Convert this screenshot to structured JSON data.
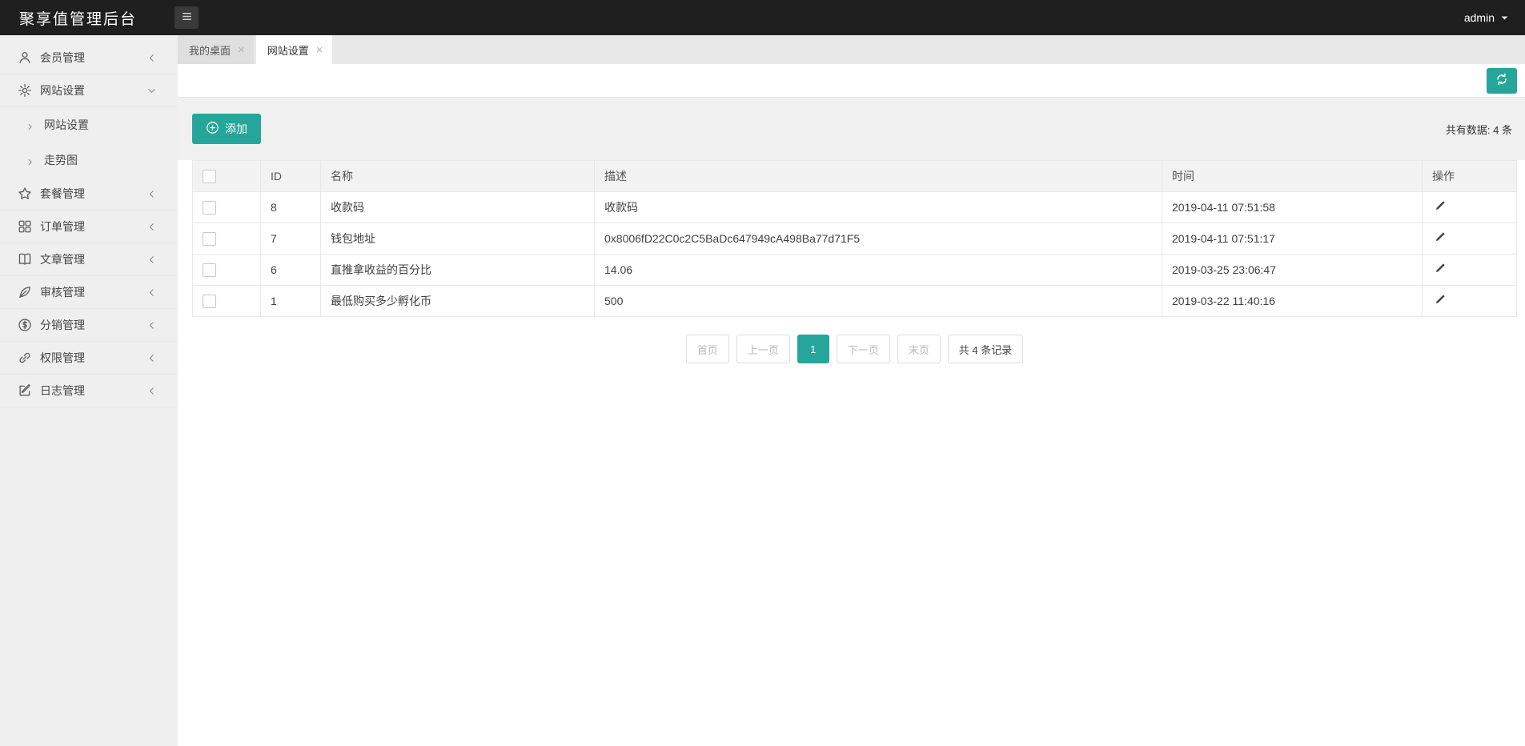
{
  "header": {
    "title": "聚享值管理后台",
    "user": "admin"
  },
  "tabs": [
    {
      "label": "我的桌面",
      "active": false
    },
    {
      "label": "网站设置",
      "active": true
    }
  ],
  "sidebar": {
    "items": [
      {
        "key": "member",
        "label": "会员管理",
        "icon": "user-icon",
        "state": "collapsed"
      },
      {
        "key": "site",
        "label": "网站设置",
        "icon": "gear-icon",
        "state": "expanded",
        "children": [
          "网站设置",
          "走势图"
        ]
      },
      {
        "key": "package",
        "label": "套餐管理",
        "icon": "star-icon",
        "state": "collapsed"
      },
      {
        "key": "order",
        "label": "订单管理",
        "icon": "grid-icon",
        "state": "collapsed"
      },
      {
        "key": "article",
        "label": "文章管理",
        "icon": "book-icon",
        "state": "collapsed"
      },
      {
        "key": "audit",
        "label": "审核管理",
        "icon": "audit-icon",
        "state": "collapsed"
      },
      {
        "key": "resell",
        "label": "分销管理",
        "icon": "dollar-icon",
        "state": "collapsed"
      },
      {
        "key": "perm",
        "label": "权限管理",
        "icon": "link-icon",
        "state": "collapsed"
      },
      {
        "key": "log",
        "label": "日志管理",
        "icon": "edit-icon",
        "state": "collapsed"
      }
    ]
  },
  "toolbar": {
    "add_label": "添加",
    "total_text": "共有数据: 4 条"
  },
  "table": {
    "headers": [
      "ID",
      "名称",
      "描述",
      "时间",
      "操作"
    ],
    "rows": [
      {
        "id": "8",
        "name": "收款码",
        "desc": "收款码",
        "time": "2019-04-11 07:51:58"
      },
      {
        "id": "7",
        "name": "钱包地址",
        "desc": "0x8006fD22C0c2C5BaDc647949cA498Ba77d71F5",
        "time": "2019-04-11 07:51:17"
      },
      {
        "id": "6",
        "name": "直推拿收益的百分比",
        "desc": "14.06",
        "time": "2019-03-25 23:06:47"
      },
      {
        "id": "1",
        "name": "最低购买多少孵化币",
        "desc": "500",
        "time": "2019-03-22 11:40:16"
      }
    ]
  },
  "pagination": {
    "items": [
      {
        "label": "首页",
        "state": "disabled"
      },
      {
        "label": "上一页",
        "state": "disabled"
      },
      {
        "label": "1",
        "state": "active"
      },
      {
        "label": "下一页",
        "state": "disabled"
      },
      {
        "label": "末页",
        "state": "disabled"
      },
      {
        "label": "共 4 条记录",
        "state": "info"
      }
    ]
  },
  "colors": {
    "accent": "#26a69a",
    "header_bg": "#1f1f1f",
    "sidebar_bg": "#efefef"
  }
}
